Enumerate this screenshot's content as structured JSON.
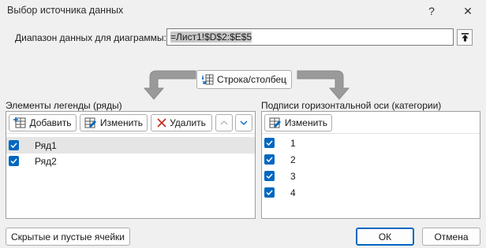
{
  "window": {
    "title": "Выбор источника данных",
    "help": "?",
    "close": "✕"
  },
  "range": {
    "label": "Диапазон данных для диаграммы:",
    "value": "=Лист1!$D$2:$E$5"
  },
  "switch_button": "Строка/столбец",
  "legend": {
    "label": "Элементы легенды (ряды)",
    "add": "Добавить",
    "edit": "Изменить",
    "remove": "Удалить",
    "items": [
      {
        "label": "Ряд1",
        "checked": true,
        "selected": true
      },
      {
        "label": "Ряд2",
        "checked": true,
        "selected": false
      }
    ]
  },
  "axis": {
    "label": "Подписи горизонтальной оси (категории)",
    "edit": "Изменить",
    "items": [
      {
        "label": "1",
        "checked": true
      },
      {
        "label": "2",
        "checked": true
      },
      {
        "label": "3",
        "checked": true
      },
      {
        "label": "4",
        "checked": true
      }
    ]
  },
  "footer": {
    "hidden_cells": "Скрытые и пустые ячейки",
    "ok": "ОК",
    "cancel": "Отмена"
  },
  "colors": {
    "accent": "#0067c0",
    "remove_icon": "#c42b1c",
    "arrow": "#a0a0a0"
  }
}
